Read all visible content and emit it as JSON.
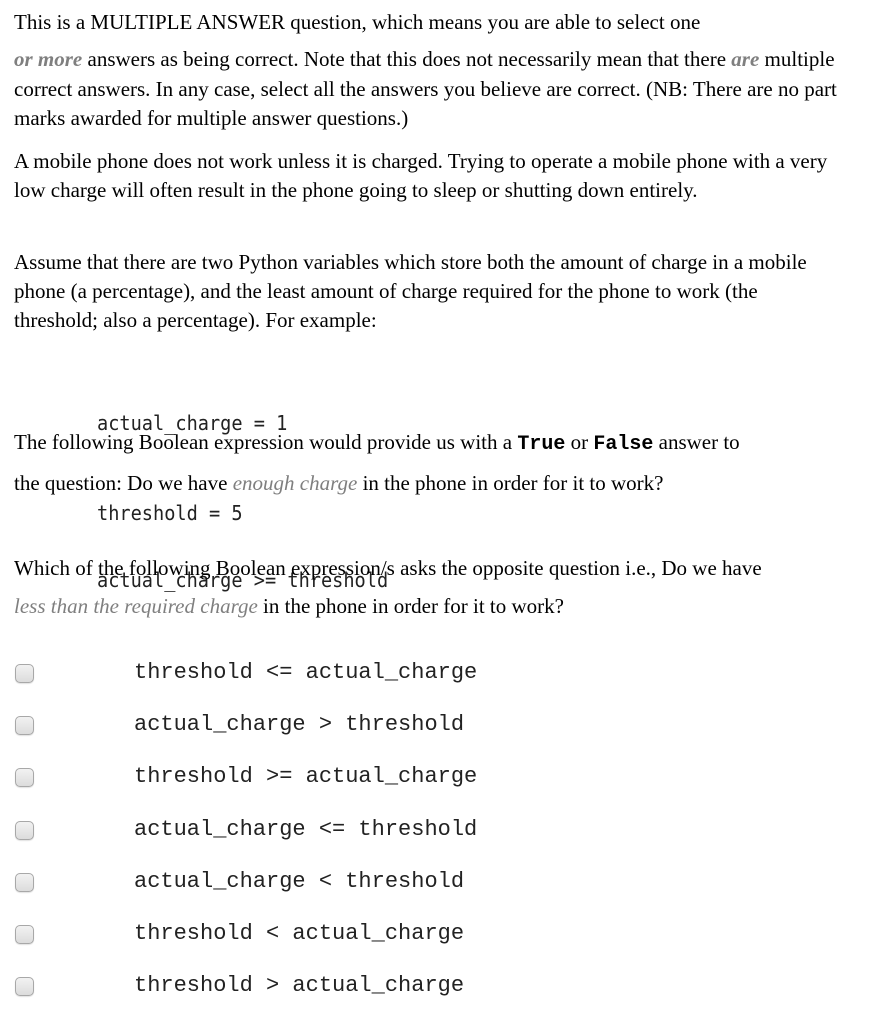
{
  "intro": {
    "line1": "This is a MULTIPLE ANSWER question, which means you are able to select one",
    "emph_or_more": "or more",
    "part2": " answers as being correct.  Note that this does not necessarily mean that there ",
    "emph_are": "are",
    "part3": " multiple correct answers.  In any case, select all the answers you believe are correct. (NB: There are no part marks awarded for multiple answer questions.)"
  },
  "context": {
    "paragraph1": "A mobile phone does not work unless it is charged.  Trying to operate a mobile phone with a very low charge will often result in the phone going to sleep or shutting down entirely.",
    "paragraph2": "Assume that there are two Python variables which store both the amount of charge in a mobile phone (a percentage), and the least amount of charge required for the phone to work (the threshold; also a percentage).  For example:"
  },
  "example_code": {
    "line1": "actual_charge = 1",
    "line2": "threshold = 5"
  },
  "boolean_intro": {
    "part1": "The following Boolean expression would provide us with a ",
    "true_kw": "True",
    "or_word": " or ",
    "false_kw": "False",
    "part2": " answer to",
    "part3": "the question: Do we have ",
    "emph": "enough charge",
    "part4": " in the phone in order for it to work?"
  },
  "reference_expression": "actual_charge >= threshold",
  "question": {
    "part1": "Which of the following Boolean expression/s asks the opposite question i.e., Do we have",
    "emph": "less than the required charge",
    "part2": " in the phone in order for it to work?"
  },
  "answers": [
    {
      "label": "threshold <= actual_charge",
      "checked": false
    },
    {
      "label": "actual_charge > threshold",
      "checked": false
    },
    {
      "label": "threshold >= actual_charge",
      "checked": false
    },
    {
      "label": "actual_charge <= threshold",
      "checked": false
    },
    {
      "label": "actual_charge < threshold",
      "checked": false
    },
    {
      "label": "threshold < actual_charge",
      "checked": false
    },
    {
      "label": "threshold > actual_charge",
      "checked": false
    }
  ],
  "colors": {
    "emphasis_gray": "#7f7f7f",
    "text": "#000000",
    "code_text": "#222222",
    "checkbox_border": "#a8a8a8"
  }
}
